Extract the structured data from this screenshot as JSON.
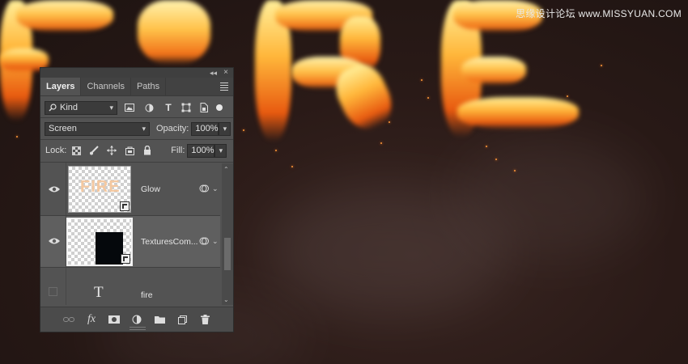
{
  "watermark": "思缘设计论坛 www.MISSYUAN.COM",
  "panel": {
    "tabs": [
      {
        "label": "Layers",
        "active": true
      },
      {
        "label": "Channels",
        "active": false
      },
      {
        "label": "Paths",
        "active": false
      }
    ],
    "filter": {
      "value": "Kind"
    },
    "blend_mode": {
      "value": "Screen"
    },
    "opacity": {
      "label": "Opacity:",
      "value": "100%"
    },
    "lock": {
      "label": "Lock:"
    },
    "fill": {
      "label": "Fill:",
      "value": "100%"
    },
    "layers": [
      {
        "name": "Glow",
        "visible": true,
        "selected": false,
        "thumb_text": "FIRE"
      },
      {
        "name": "TexturesCom...",
        "visible": true,
        "selected": true
      },
      {
        "name": "fire",
        "visible": false,
        "selected": false,
        "type": "text"
      }
    ]
  },
  "colors": {
    "panel_bg": "#535353",
    "fire_hot": "#ffc24a",
    "background": "#2a1a17"
  }
}
